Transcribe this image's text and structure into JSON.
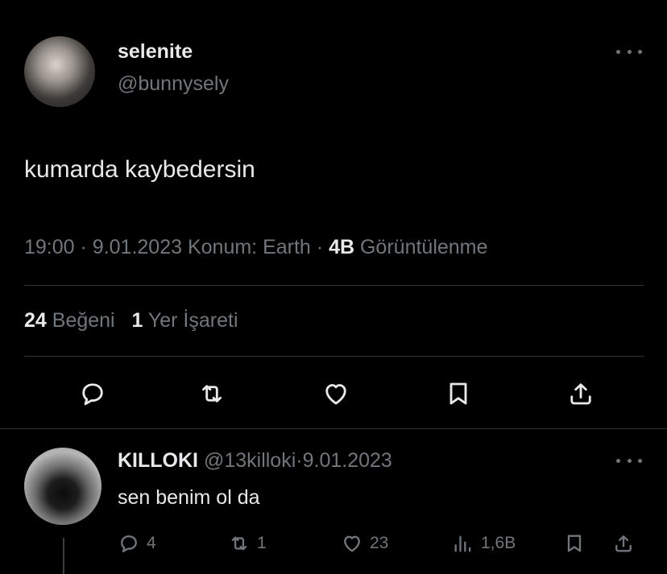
{
  "tweet": {
    "display_name": "selenite",
    "handle": "@bunnysely",
    "text": "kumarda kaybedersin",
    "time": "19:00",
    "sep1": "·",
    "date": "9.01.2023",
    "location": "Konum: Earth",
    "sep2": "·",
    "views_count": "4B",
    "views_label": "Görüntülenme",
    "likes_count": "24",
    "likes_label": "Beğeni",
    "bookmarks_count": "1",
    "bookmarks_label": "Yer İşareti",
    "actions": [
      "reply-icon",
      "retweet-icon",
      "like-icon",
      "bookmark-icon",
      "share-icon"
    ]
  },
  "reply": {
    "display_name": "KILLOKI",
    "handle": "@13killoki",
    "sep": "·",
    "date": "9.01.2023",
    "text": "sen benim ol da",
    "reply_count": "4",
    "retweet_count": "1",
    "like_count": "23",
    "views_count": "1,6B"
  },
  "colors": {
    "background": "#000000",
    "primary_text": "#e7e9ea",
    "secondary_text": "#71767b",
    "divider": "#2f3336"
  }
}
